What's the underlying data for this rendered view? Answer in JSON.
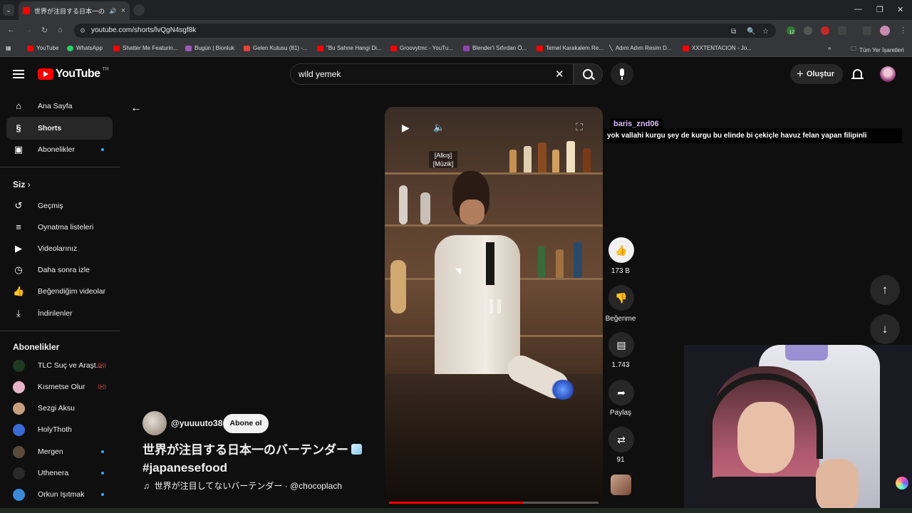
{
  "browser": {
    "tab_title": "世界が注目する日本一のバーテ",
    "url": "youtube.com/shorts/lvQgN4sgf8k",
    "bookmarks": [
      "YouTube",
      "WhatsApp",
      "Shatter Me Featurin...",
      "Bugün | Bionluk",
      "Gelen Kutusu (81) -...",
      "\"Bu Sahne Hangi Di...",
      "Groovytmc - YouTu...",
      "Blender'i Sıfırdan Ö...",
      "Temel Karakalem Re...",
      "Adım Adım Resim D...",
      "XXXTENTACION - Jo..."
    ],
    "all_bookmarks": "Tüm Yer İşaretleri",
    "ext_badge": "12"
  },
  "header": {
    "logo_text": "YouTube",
    "country_code": "TR",
    "search_value": "wild yemek",
    "create_label": "Oluştur"
  },
  "sidebar": {
    "main": [
      {
        "label": "Ana Sayfa"
      },
      {
        "label": "Shorts"
      },
      {
        "label": "Abonelikler"
      }
    ],
    "you_title": "Siz",
    "you_items": [
      {
        "label": "Geçmiş"
      },
      {
        "label": "Oynatma listeleri"
      },
      {
        "label": "Videolarınız"
      },
      {
        "label": "Daha sonra izle"
      },
      {
        "label": "Beğendiğim videolar"
      },
      {
        "label": "İndirilenler"
      }
    ],
    "subs_title": "Abonelikler",
    "subs": [
      {
        "label": "TLC Suç ve Araşt...",
        "color": "#1e3a22"
      },
      {
        "label": "Kısmetse Olur",
        "color": "#e8b4c8"
      },
      {
        "label": "Sezgi Aksu",
        "color": "#c8a080"
      },
      {
        "label": "HolyThoth",
        "color": "#3a6ad8"
      },
      {
        "label": "Mergen",
        "color": "#5a4a3a"
      },
      {
        "label": "Uthenera",
        "color": "#2a2a2a"
      },
      {
        "label": "Orkun Işıtmak",
        "color": "#3a8ad8"
      }
    ]
  },
  "video": {
    "captions_line1": "[Alkış]",
    "captions_line2": "[Müzik]",
    "progress": 0.64
  },
  "chat": {
    "user": "baris_znd06",
    "message": "yok vallahi kurgu şey de kurgu bu elinde bi çekiçle havuz felan yapan filipinli"
  },
  "actions": {
    "likes": "173 B",
    "dislike_label": "Beğenme",
    "comments": "1.743",
    "share_label": "Paylaş",
    "remix_count": "91"
  },
  "short": {
    "handle": "@yuuuuto38",
    "subscribe_label": "Abone ol",
    "title_line1": "世界が注目する日本一のバーテンダー",
    "title_line2": "#japanesefood",
    "music": "世界が注目してないバーテンダー · @chocoplach"
  }
}
